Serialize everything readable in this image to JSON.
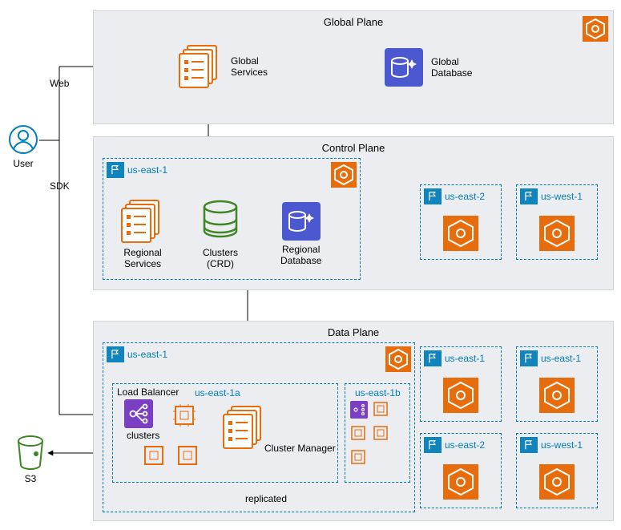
{
  "user_label": "User",
  "web_label": "Web",
  "sdk_label": "SDK",
  "s3_label": "S3",
  "global_plane": {
    "title": "Global Plane",
    "services": "Global\nServices",
    "database": "Global\nDatabase"
  },
  "control_plane": {
    "title": "Control Plane",
    "region": "us-east-1",
    "regional_services": "Regional\nServices",
    "clusters": "Clusters\n(CRD)",
    "regional_db": "Regional\nDatabase",
    "tiles": [
      "us-east-2",
      "us-west-1"
    ]
  },
  "data_plane": {
    "title": "Data Plane",
    "region": "us-east-1",
    "zone_a": {
      "name": "us-east-1a",
      "lb": "Load Balancer",
      "clusters": "clusters",
      "cm": "Cluster Manager"
    },
    "zone_b": {
      "name": "us-east-1b",
      "replicated": "replicated"
    },
    "tiles": [
      "us-east-1",
      "us-east-1",
      "us-east-2",
      "us-west-1"
    ]
  }
}
